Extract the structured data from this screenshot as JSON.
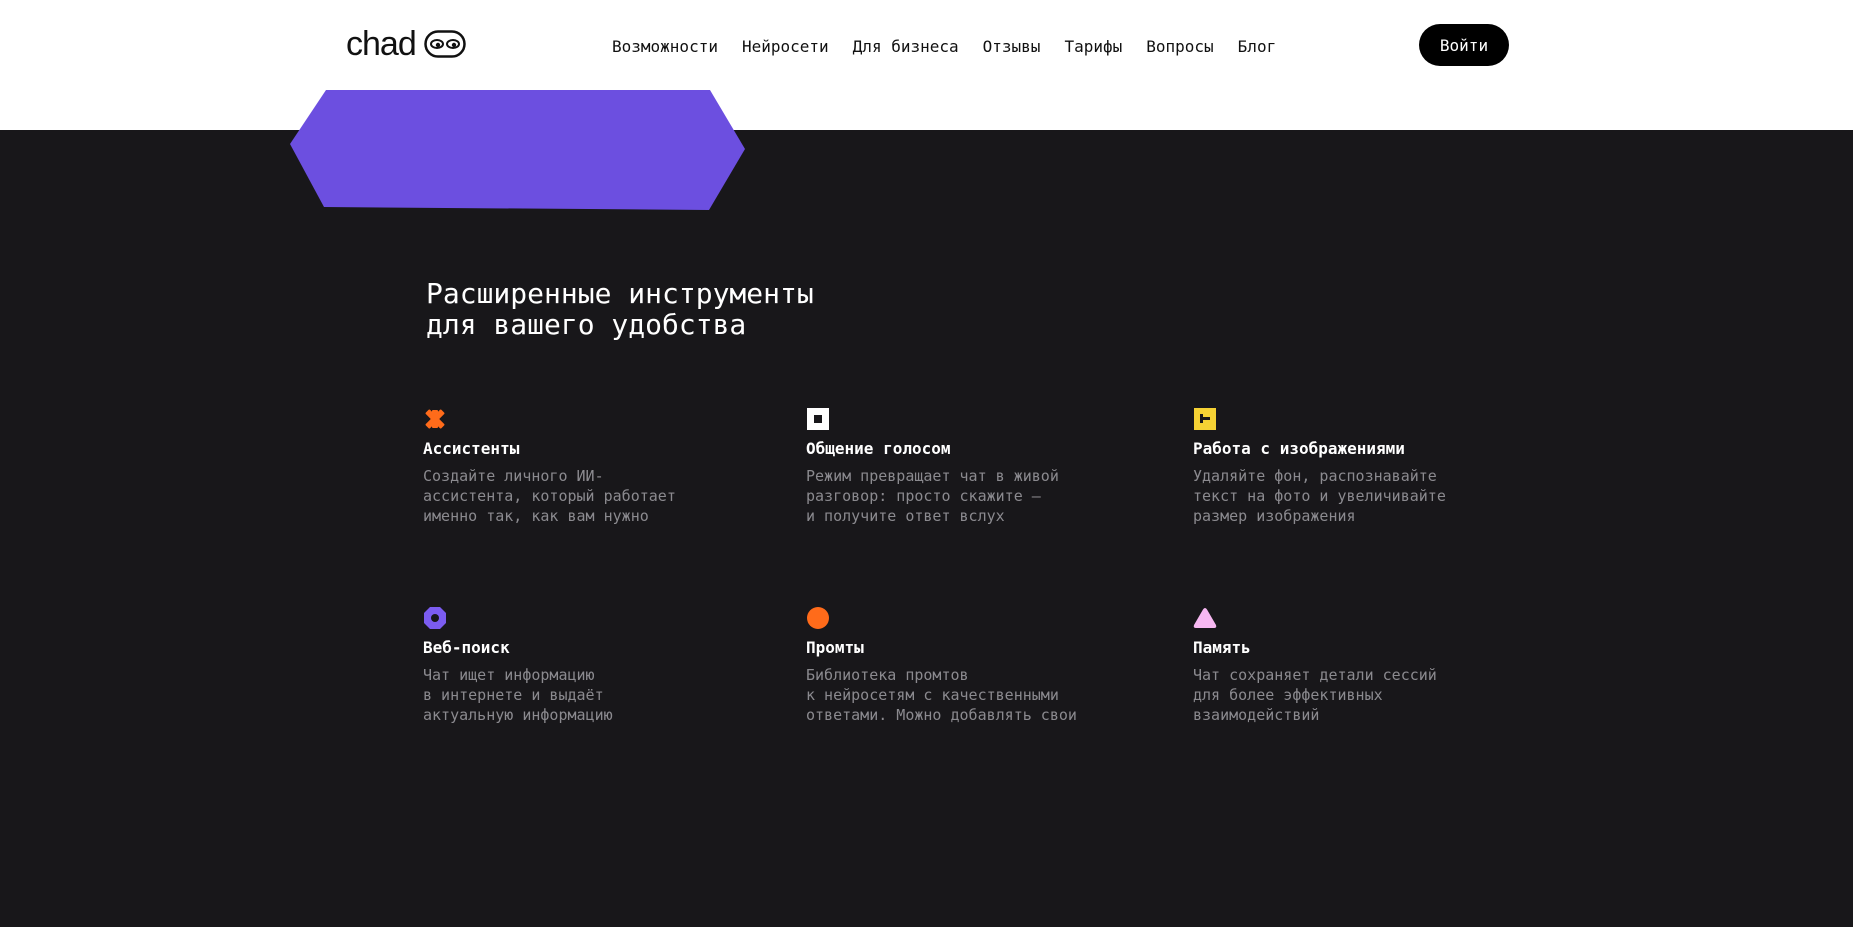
{
  "header": {
    "logo_text": "chad",
    "nav": [
      {
        "label": "Возможности"
      },
      {
        "label": "Нейросети"
      },
      {
        "label": "Для бизнеса"
      },
      {
        "label": "Отзывы"
      },
      {
        "label": "Тарифы"
      },
      {
        "label": "Вопросы"
      },
      {
        "label": "Блог"
      }
    ],
    "login_label": "Войти"
  },
  "section": {
    "title_lines": [
      "Расширенные инструменты",
      "для вашего удобства"
    ]
  },
  "features": [
    {
      "icon": "asterisk-icon",
      "icon_color": "#ff6b1a",
      "title": "Ассистенты",
      "desc_lines": [
        "Создайте личного ИИ-",
        "ассистента, который работает",
        "именно так, как вам нужно"
      ]
    },
    {
      "icon": "square-frame-icon",
      "icon_color": "#ffffff",
      "title": "Общение голосом",
      "desc_lines": [
        "Режим превращает чат в живой",
        "разговор: просто скажите —",
        "и получите ответ вслух"
      ]
    },
    {
      "icon": "image-tool-icon",
      "icon_color": "#f5d234",
      "title": "Работа с изображениями",
      "desc_lines": [
        "Удаляйте фон, распознавайте",
        "текст на фото и увеличивайте",
        "размер изображения"
      ]
    },
    {
      "icon": "octagon-ring-icon",
      "icon_color": "#7b5cf0",
      "title": "Веб-поиск",
      "desc_lines": [
        "Чат ищет информацию",
        "в интернете и выдаёт",
        "актуальную информацию"
      ]
    },
    {
      "icon": "circle-icon",
      "icon_color": "#ff6b1a",
      "title": "Промты",
      "desc_lines": [
        "Библиотека промтов",
        "к нейросетям с качественными",
        "ответами. Можно добавлять свои"
      ]
    },
    {
      "icon": "triangle-icon",
      "icon_color": "#f7b8f2",
      "title": "Память",
      "desc_lines": [
        "Чат сохраняет детали сессий",
        "для более эффективных",
        "взаимодействий"
      ]
    }
  ],
  "colors": {
    "hero_shape": "#6c4fe0",
    "background_dark": "#18171a",
    "header_bg": "#ffffff"
  }
}
